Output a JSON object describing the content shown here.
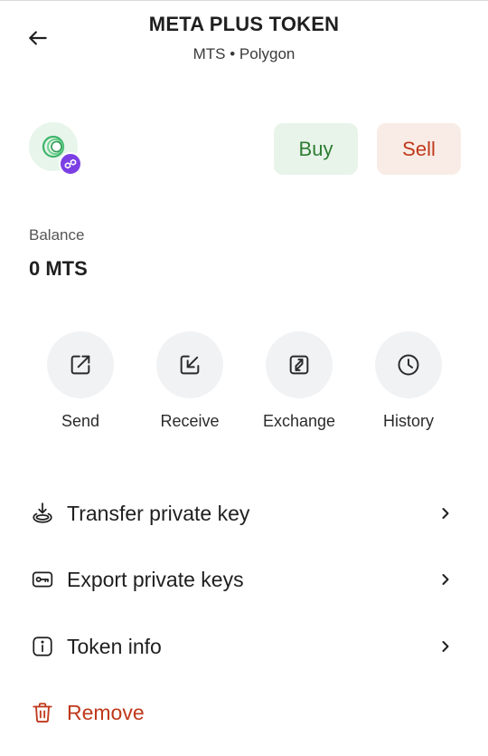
{
  "header": {
    "title": "META PLUS TOKEN",
    "subtitle": "MTS • Polygon",
    "back_icon": "arrow-left-icon"
  },
  "token": {
    "logo_icon": "token-logo-icon",
    "chain_badge_icon": "polygon-icon",
    "logo_bg": "#e7f5ea",
    "chain_color": "#7b3fe4"
  },
  "trade": {
    "buy_label": "Buy",
    "sell_label": "Sell",
    "buy_color": "#2e7d32",
    "sell_color": "#c0391b"
  },
  "balance": {
    "label": "Balance",
    "value": "0 MTS"
  },
  "actions": [
    {
      "label": "Send",
      "icon": "send-icon"
    },
    {
      "label": "Receive",
      "icon": "receive-icon"
    },
    {
      "label": "Exchange",
      "icon": "exchange-icon"
    },
    {
      "label": "History",
      "icon": "clock-icon"
    }
  ],
  "menu": [
    {
      "label": "Transfer private key",
      "icon": "download-tray-icon"
    },
    {
      "label": "Export private keys",
      "icon": "key-icon"
    },
    {
      "label": "Token info",
      "icon": "info-icon"
    },
    {
      "label": "Remove",
      "icon": "trash-icon"
    }
  ]
}
